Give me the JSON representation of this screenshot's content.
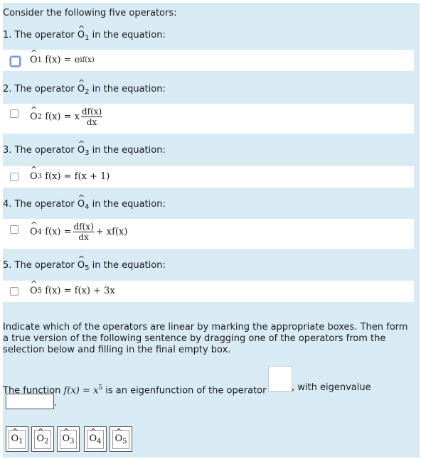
{
  "intro": "Consider the following five operators:",
  "questions": [
    {
      "prefix": "1. The operator ",
      "sub": "1",
      "suffix": " in the equation:"
    },
    {
      "prefix": "2. The operator ",
      "sub": "2",
      "suffix": " in the equation:"
    },
    {
      "prefix": "3. The operator ",
      "sub": "3",
      "suffix": " in the equation:"
    },
    {
      "prefix": "4. The operator ",
      "sub": "4",
      "suffix": " in the equation:"
    },
    {
      "prefix": "5. The operator ",
      "sub": "5",
      "suffix": " in the equation:"
    }
  ],
  "operator_letter": "O",
  "equations": {
    "e1": {
      "lhs": "f(x) = e",
      "sup": "if(x)"
    },
    "e2": {
      "lhs": "f(x) = x",
      "num": "df(x)",
      "den": "dx"
    },
    "e3": {
      "lhs": "f(x) = f(x + 1)"
    },
    "e4": {
      "lhs": "f(x) =",
      "num": "df(x)",
      "den": "dx",
      "rhs": "+ xf(x)"
    },
    "e5": {
      "lhs": "f(x) = f(x) + 3x"
    }
  },
  "checked": [
    true,
    false,
    false,
    false,
    false
  ],
  "instructions": "Indicate which of the operators are linear by marking the appropriate boxes. Then form a true version of the following sentence by dragging one of the operators from the selection below and filling in the final empty box.",
  "sentence": {
    "part1": "The function ",
    "func": "f(x) = x",
    "exp": "5",
    "part2": " is an eigenfunction of the operator",
    "part3": ", with eigenvalue",
    "period": "."
  },
  "tiles": [
    "1",
    "2",
    "3",
    "4",
    "5"
  ],
  "colors": {
    "panel": "#d8ebf4",
    "checkbox_selected": "#7b96d6"
  }
}
